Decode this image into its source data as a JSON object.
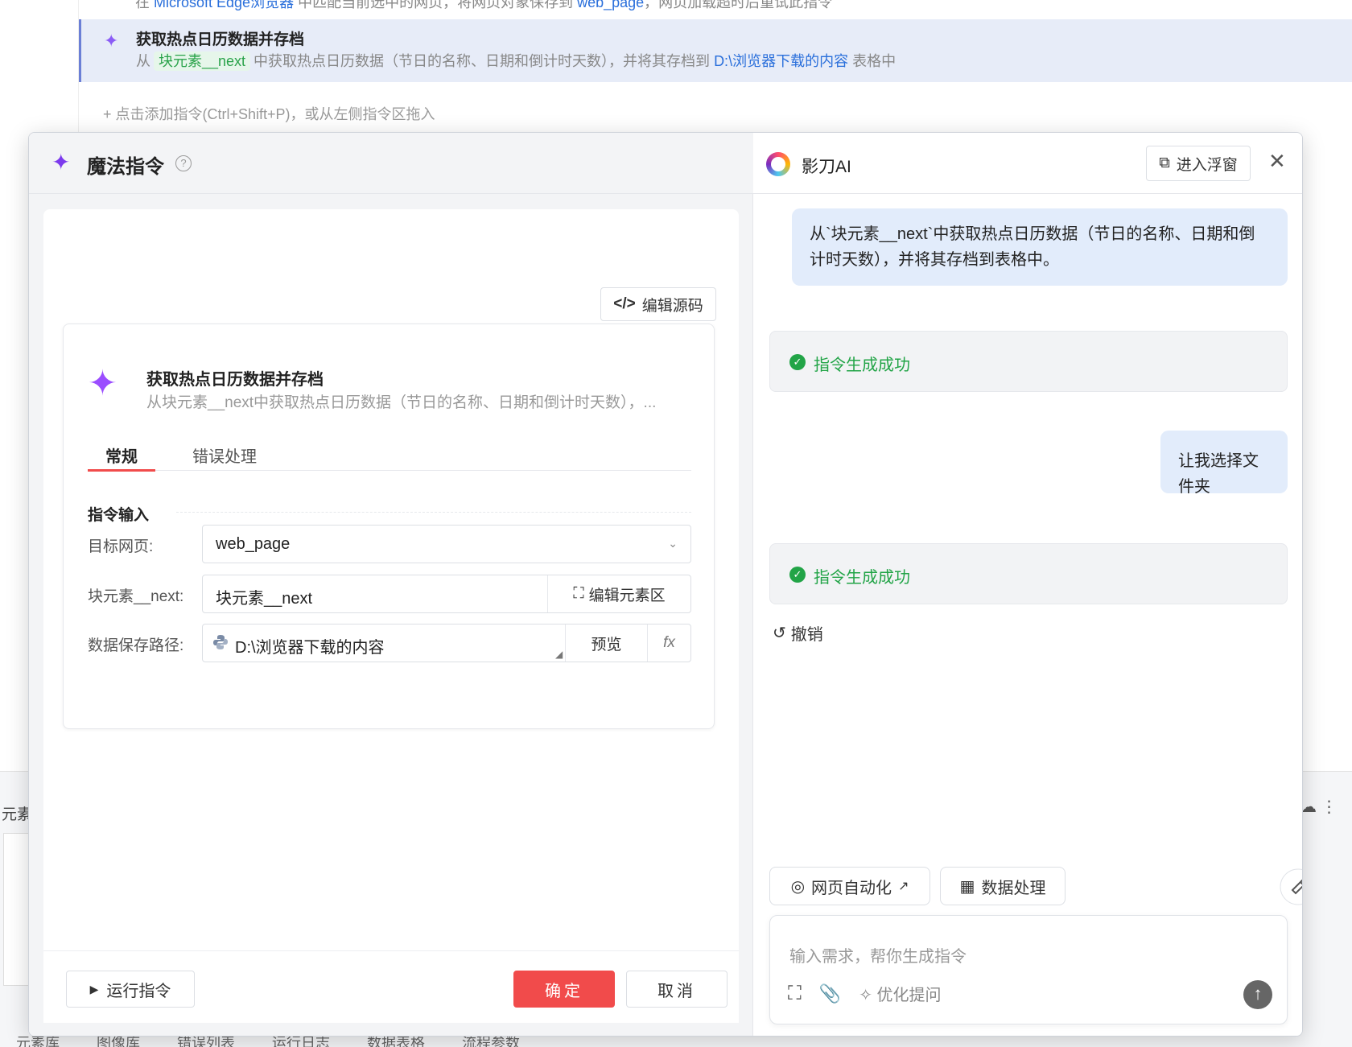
{
  "background": {
    "row1": {
      "text_a": "在 ",
      "link_a": "Microsoft Edge浏览器",
      "text_b": " 中匹配当前选中的网页，将网页对象保存到 ",
      "link_b": "web_page",
      "text_c": "，网页加载超时后重试此指令"
    },
    "selected_row": {
      "title": "获取热点日历数据并存档",
      "desc_a": "从",
      "chip": "块元素__next",
      "desc_b": "中获取热点日历数据（节日的名称、日期和倒计时天数），并将其存档到",
      "link": "D:\\浏览器下载的内容",
      "desc_c": "表格中"
    },
    "add_hint": "+  点击添加指令(Ctrl+Shift+P)，或从左侧指令区拖入",
    "bottom_label": "元素",
    "bottom_tabs": [
      "元素库",
      "图像库",
      "错误列表",
      "运行日志",
      "数据表格",
      "流程参数"
    ]
  },
  "dialog": {
    "title": "魔法指令",
    "help": "?",
    "edit_source": "编辑源码",
    "card": {
      "title": "获取热点日历数据并存档",
      "desc": "从块元素__next中获取热点日历数据（节日的名称、日期和倒计时天数），..."
    },
    "tabs": [
      "常规",
      "错误处理"
    ],
    "section": "指令输入",
    "fields": {
      "target": {
        "label": "目标网页:",
        "value": "web_page"
      },
      "element": {
        "label": "块元素__next:",
        "value": "块元素__next",
        "action": "编辑元素区"
      },
      "path": {
        "label": "数据保存路径:",
        "value": "D:\\浏览器下载的内容",
        "preview": "预览",
        "fx": "fx"
      }
    },
    "run": "运行指令",
    "ok": "确定",
    "cancel": "取消"
  },
  "assistant": {
    "title": "影刀AI",
    "float": "进入浮窗",
    "messages": {
      "user1": "从`块元素__next`中获取热点日历数据（节日的名称、日期和倒计时天数），并将其存档到表格中。",
      "ok1": "指令生成成功",
      "user2": "让我选择文件夹",
      "ok2": "指令生成成功",
      "undo": "撤销"
    },
    "chips": {
      "web": "网页自动化",
      "data": "数据处理"
    },
    "input_placeholder": "输入需求，帮你生成指令",
    "optimize": "优化提问"
  },
  "colors": {
    "accent_red": "#f14b4b",
    "success_green": "#22a447",
    "user_bubble": "#e2ecfb",
    "magic_purple": "#9b4dff"
  }
}
